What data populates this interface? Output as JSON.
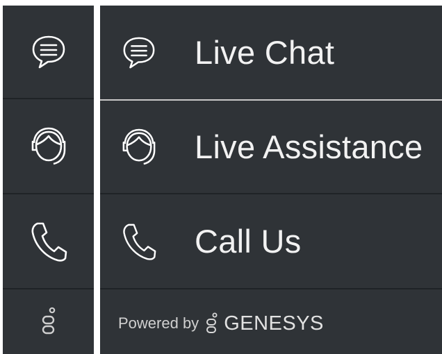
{
  "menu": {
    "items": [
      {
        "label": "Live Chat",
        "icon": "chat-bubble-icon"
      },
      {
        "label": "Live Assistance",
        "icon": "headset-agent-icon"
      },
      {
        "label": "Call Us",
        "icon": "phone-icon"
      }
    ],
    "footer": {
      "prefix": "Powered by",
      "brand": "GENESYS",
      "icon": "genesys-logo-icon"
    }
  },
  "colors": {
    "panel_bg": "#2f3337",
    "icon_stroke": "#ffffff",
    "label_text": "#f2f2f2"
  }
}
